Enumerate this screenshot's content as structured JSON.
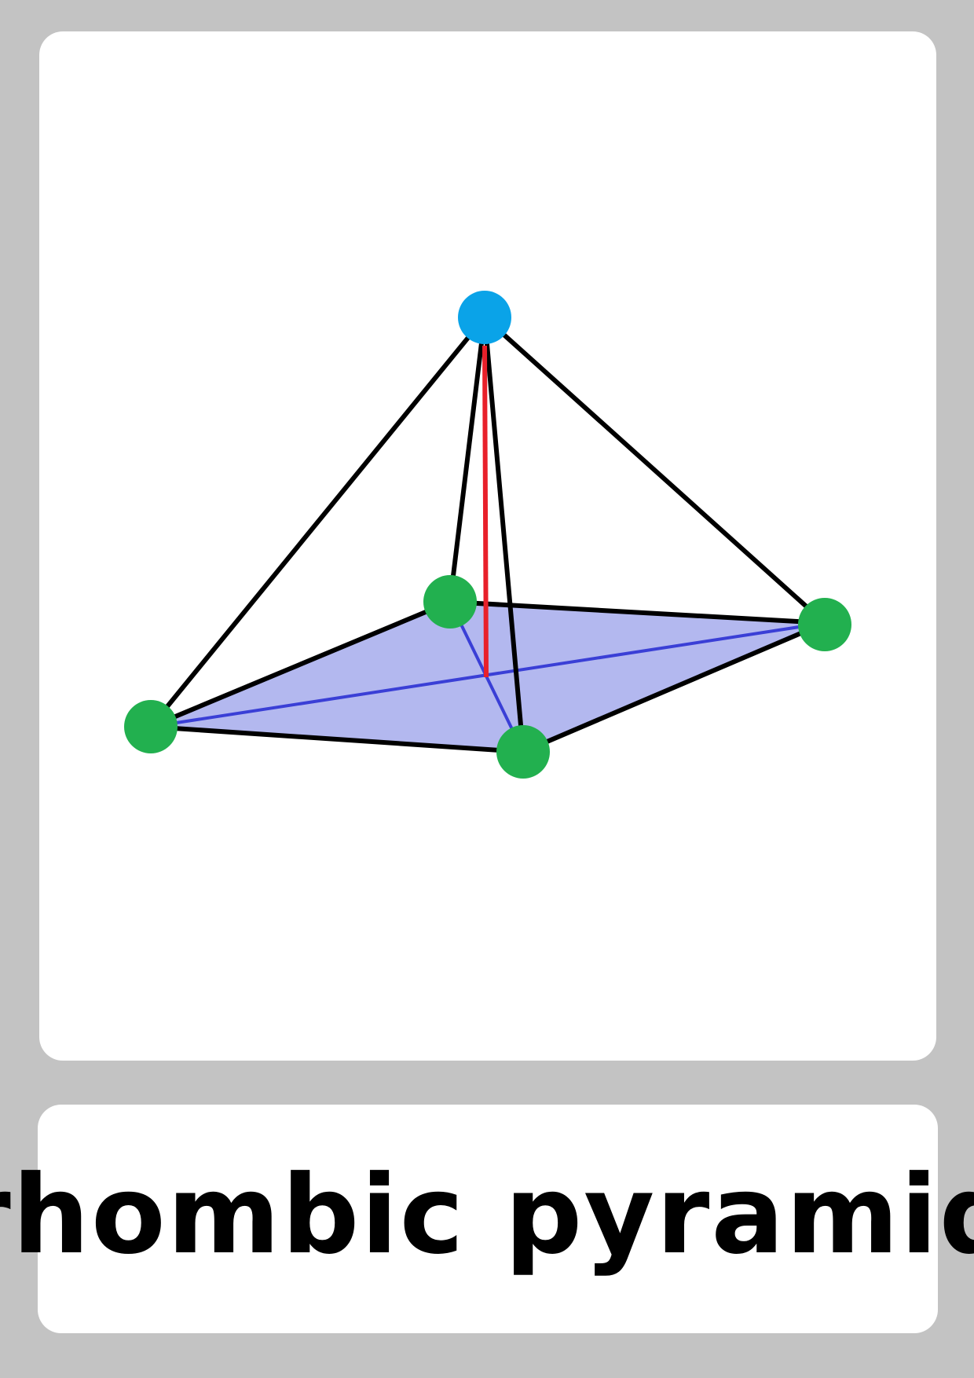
{
  "card": {
    "word": "rhombic pyramid"
  },
  "colors": {
    "background": "#c3c3c3",
    "card": "#ffffff",
    "base_fill": "#b3b8ef",
    "base_diagonal": "#3a3fd6",
    "edge": "#000000",
    "height_line": "#e8202a",
    "apex_vertex": "#0aa3e8",
    "base_vertex": "#22b04f"
  },
  "icons": {
    "figure": "rhombic-pyramid-icon"
  }
}
